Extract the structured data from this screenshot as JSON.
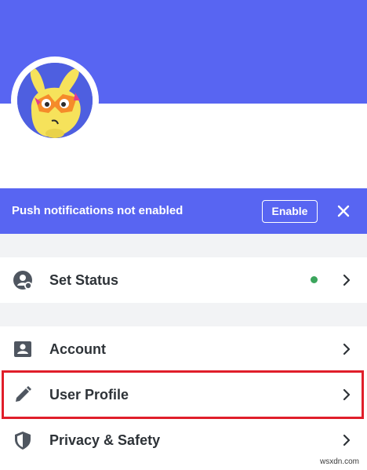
{
  "notification": {
    "text": "Push notifications not enabled",
    "enable_label": "Enable"
  },
  "menu": [
    {
      "label": "Set Status",
      "icon": "status-user-icon",
      "status_color": "#3ba55c"
    },
    {
      "label": "Account",
      "icon": "account-card-icon"
    },
    {
      "label": "User Profile",
      "icon": "pencil-icon",
      "highlighted": true
    },
    {
      "label": "Privacy & Safety",
      "icon": "shield-icon"
    }
  ],
  "colors": {
    "brand": "#5865f2",
    "highlight_box": "#e01e2a",
    "online": "#3ba55c",
    "separator": "#f2f3f5"
  },
  "watermark": "wsxdn.com"
}
